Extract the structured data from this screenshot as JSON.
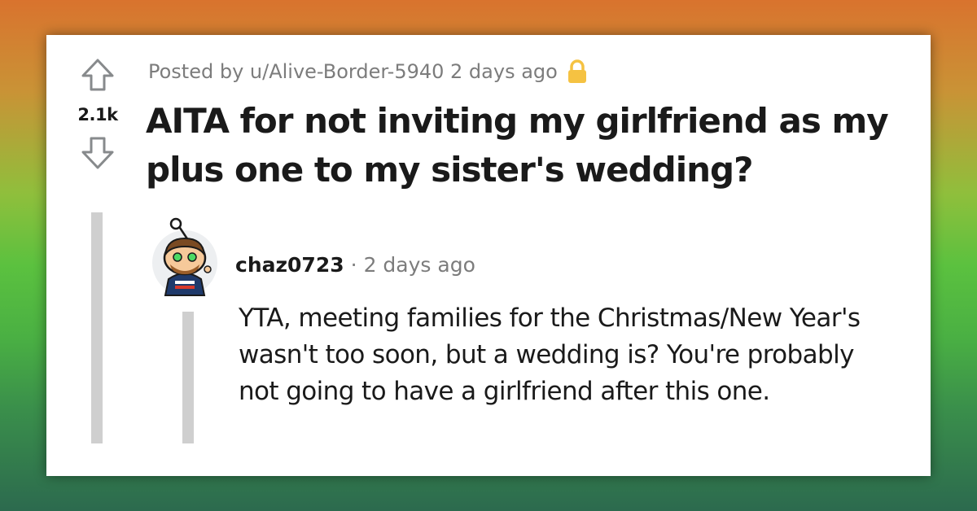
{
  "post": {
    "vote_count": "2.1k",
    "meta": "Posted by u/Alive-Border-5940 2 days ago",
    "title": "AITA for not inviting my girlfriend as my plus one to my sister's wedding?",
    "icons": {
      "upvote": "arrow-up-outline-icon",
      "downvote": "arrow-down-outline-icon",
      "locked": "lock-icon"
    }
  },
  "comment": {
    "author": "chaz0723",
    "separator": "·",
    "time": "2 days ago",
    "body": "YTA, meeting families for the Christmas/New Year's wasn't too soon, but a wedding is? You're probably not going to have a girlfriend after this one.",
    "avatar": "snoo-avatar"
  },
  "colors": {
    "lock": "#f5c242",
    "meta_text": "#7c7c7c",
    "thread_line": "#cfcfcf",
    "title_text": "#1a1a1a"
  }
}
